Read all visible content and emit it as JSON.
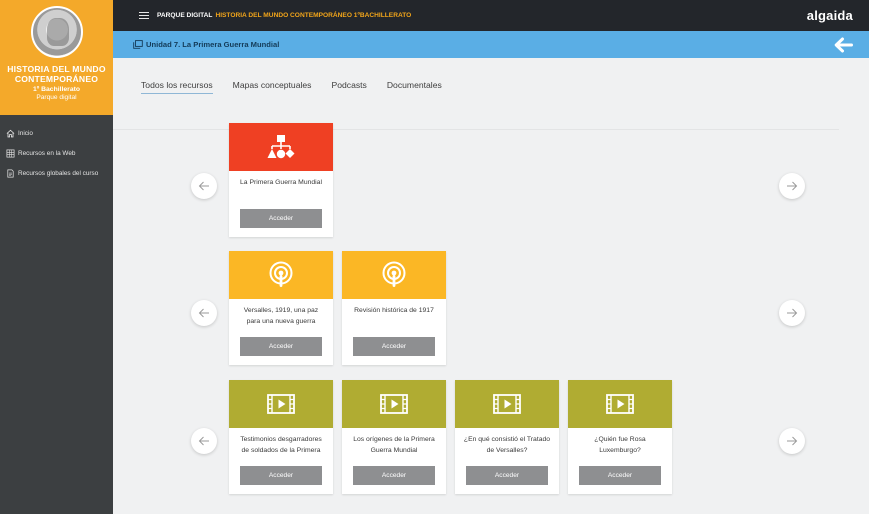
{
  "sidebar": {
    "brand_title": "HISTORIA DEL MUNDO CONTEMPORÁNEO",
    "brand_course": "1º Bachillerato",
    "brand_sub": "Parque digital",
    "items": [
      {
        "label": "Inicio",
        "icon": "home-icon"
      },
      {
        "label": "Recursos en la Web",
        "icon": "grid-icon"
      },
      {
        "label": "Recursos globales del curso",
        "icon": "document-icon"
      }
    ]
  },
  "topbar": {
    "prefix": "PARQUE DIGITAL",
    "highlight": "HISTORIA DEL MUNDO CONTEMPORÁNEO 1ºBACHILLERATO",
    "publisher": "algaida"
  },
  "unitbar": {
    "title": "Unidad 7. La Primera Guerra Mundial"
  },
  "tabs": [
    {
      "label": "Todos los recursos",
      "active": true
    },
    {
      "label": "Mapas conceptuales",
      "active": false
    },
    {
      "label": "Podcasts",
      "active": false
    },
    {
      "label": "Documentales",
      "active": false
    }
  ],
  "colors": {
    "accent_orange": "#f4a92a",
    "concept_red": "#ef4023",
    "podcast_orange": "#fbb725",
    "video_olive": "#b0ac32",
    "unit_blue": "#5aaee5"
  },
  "rows": [
    {
      "type": "mapa-conceptual",
      "icon": "concept-map-icon",
      "cards": [
        {
          "title": "La Primera Guerra Mundial",
          "button": "Acceder"
        }
      ]
    },
    {
      "type": "podcast",
      "icon": "podcast-icon",
      "cards": [
        {
          "title": "Versalles, 1919, una paz para una nueva guerra",
          "button": "Acceder"
        },
        {
          "title": "Revisión histórica de 1917",
          "button": "Acceder"
        }
      ]
    },
    {
      "type": "documental",
      "icon": "video-icon",
      "cards": [
        {
          "title": "Testimonios desgarradores de soldados de la Primera",
          "button": "Acceder"
        },
        {
          "title": "Los orígenes de la Primera Guerra Mundial",
          "button": "Acceder"
        },
        {
          "title": "¿En qué consistió el Tratado de Versalles?",
          "button": "Acceder"
        },
        {
          "title": "¿Quién fue Rosa Luxemburgo?",
          "button": "Acceder"
        }
      ]
    }
  ]
}
